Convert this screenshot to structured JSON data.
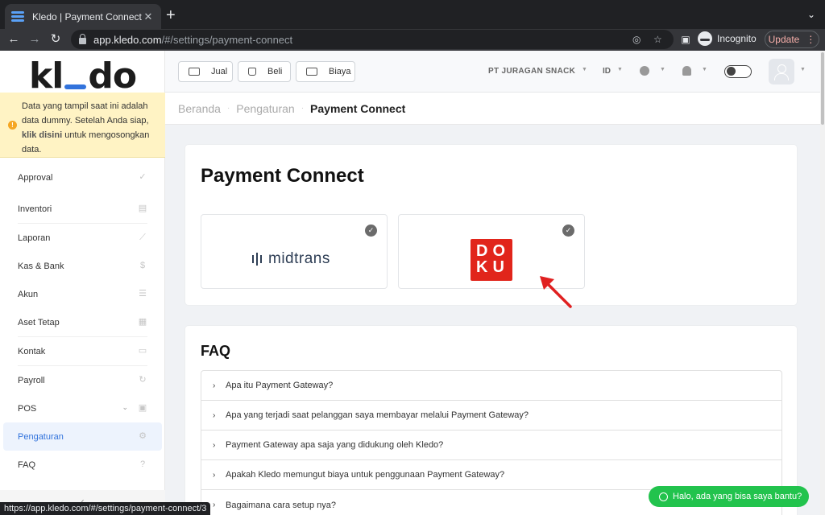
{
  "browser": {
    "tab_title": "Kledo | Payment Connect",
    "tab_close": "✕",
    "new_tab": "+",
    "url_host": "app.kledo.com",
    "url_path": "/#/settings/payment-connect",
    "incognito_label": "Incognito",
    "update_label": "Update",
    "status_url": "https://app.kledo.com/#/settings/payment-connect/3"
  },
  "sidebar": {
    "logo_k": "kl",
    "logo_rest": "do",
    "notice_text_1": "Data yang tampil saat ini adalah data dummy. Setelah Anda siap, ",
    "notice_link": "klik disini",
    "notice_text_2": " untuk mengosongkan data.",
    "items": [
      {
        "label": "Approval",
        "icon": "check-icon"
      },
      {
        "label": "Inventori",
        "icon": "box-icon"
      },
      {
        "label": "Laporan",
        "icon": "chart-icon"
      },
      {
        "label": "Kas & Bank",
        "icon": "dollar-icon"
      },
      {
        "label": "Akun",
        "icon": "list-icon"
      },
      {
        "label": "Aset Tetap",
        "icon": "building-icon"
      },
      {
        "label": "Kontak",
        "icon": "contact-card-icon"
      },
      {
        "label": "Payroll",
        "icon": "refresh-icon"
      },
      {
        "label": "POS",
        "icon": "pos-icon"
      },
      {
        "label": "Pengaturan",
        "icon": "gears-icon"
      },
      {
        "label": "FAQ",
        "icon": "question-icon"
      }
    ],
    "collapse_label": "‹"
  },
  "header": {
    "buttons": [
      {
        "label": "Jual",
        "icon": "shop-icon"
      },
      {
        "label": "Beli",
        "icon": "bag-icon"
      },
      {
        "label": "Biaya",
        "icon": "wallet-icon"
      }
    ],
    "company": "PT JURAGAN SNACK",
    "language": "ID"
  },
  "breadcrumb": {
    "items": [
      "Beranda",
      "Pengaturan"
    ],
    "current": "Payment Connect",
    "separator": "·"
  },
  "payment_connect": {
    "title": "Payment Connect",
    "providers": [
      {
        "name": "midtrans",
        "connected": true
      },
      {
        "name": "DOKU",
        "connected": true
      }
    ],
    "doku_line1": "DO",
    "doku_line2": "KU"
  },
  "faq": {
    "title": "FAQ",
    "questions": [
      "Apa itu Payment Gateway?",
      "Apa yang terjadi saat pelanggan saya membayar melalui Payment Gateway?",
      "Payment Gateway apa saja yang didukung oleh Kledo?",
      "Apakah Kledo memungut biaya untuk penggunaan Payment Gateway?",
      "Bagaimana cara setup nya?"
    ]
  },
  "chat": {
    "label": "Halo, ada yang bisa saya bantu?"
  },
  "colors": {
    "brand_blue": "#3273dc",
    "doku_red": "#e1251b",
    "whatsapp_green": "#22c34d",
    "arrow_red": "#e02020"
  }
}
